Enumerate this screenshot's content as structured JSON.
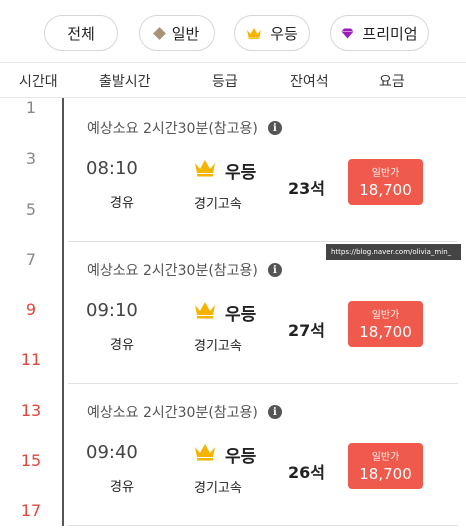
{
  "filters": [
    {
      "label": "전체",
      "icon": ""
    },
    {
      "label": "일반",
      "icon": "diamond-icon",
      "color": "#a89279"
    },
    {
      "label": "우등",
      "icon": "crown-icon",
      "color": "#f5b400"
    },
    {
      "label": "프리미엄",
      "icon": "gem-icon",
      "color": "#9b1fb6"
    }
  ],
  "columns": [
    "시간대",
    "출발시간",
    "등급",
    "잔여석",
    "요금"
  ],
  "hours": [
    {
      "label": "1",
      "color": "#888888"
    },
    {
      "label": "3",
      "color": "#888888"
    },
    {
      "label": "5",
      "color": "#888888"
    },
    {
      "label": "7",
      "color": "#888888"
    },
    {
      "label": "9",
      "color": "#e0463a"
    },
    {
      "label": "11",
      "color": "#e0463a"
    },
    {
      "label": "13",
      "color": "#e0463a"
    },
    {
      "label": "15",
      "color": "#e0463a"
    },
    {
      "label": "17",
      "color": "#e0463a"
    }
  ],
  "buses": [
    {
      "estimate": "예상소요 2시간30분(참고용)",
      "time": "08:10",
      "via": "경유",
      "grade": "우등",
      "road": "경기고속",
      "seats": "23석",
      "fare_label": "일반가",
      "fare": "18,700"
    },
    {
      "estimate": "예상소요 2시간30분(참고용)",
      "time": "09:10",
      "via": "경유",
      "grade": "우등",
      "road": "경기고속",
      "seats": "27석",
      "fare_label": "일반가",
      "fare": "18,700"
    },
    {
      "estimate": "예상소요 2시간30분(참고용)",
      "time": "09:40",
      "via": "경유",
      "grade": "우등",
      "road": "경기고속",
      "seats": "26석",
      "fare_label": "일반가",
      "fare": "18,700"
    }
  ],
  "watermark": "https://blog.naver.com/olivia_min_",
  "colors": {
    "accent": "#ef5a4c",
    "crown": "#f5b400"
  }
}
